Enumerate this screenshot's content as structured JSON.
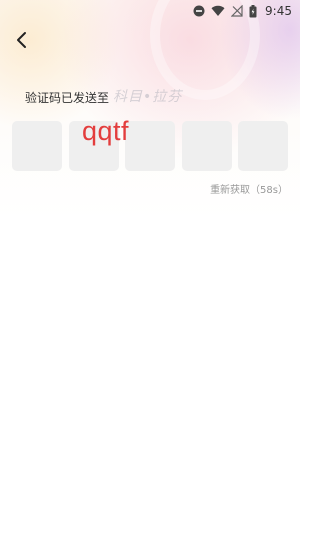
{
  "status_bar": {
    "time": "9:45",
    "icons": [
      "dnd-icon",
      "wifi-icon",
      "no-sim-icon",
      "battery-icon"
    ]
  },
  "header": {
    "back_icon": "chevron-left-icon"
  },
  "verification": {
    "sent_label": "验证码已发送至",
    "phone_watermark": "科目•拉芬",
    "captcha_text": "qqtf",
    "code_box_count": 5,
    "resend_label": "重新获取（58s）"
  },
  "colors": {
    "captcha_text": "#e33d3d",
    "code_box_bg": "#efefef",
    "resend_text": "#999999"
  }
}
